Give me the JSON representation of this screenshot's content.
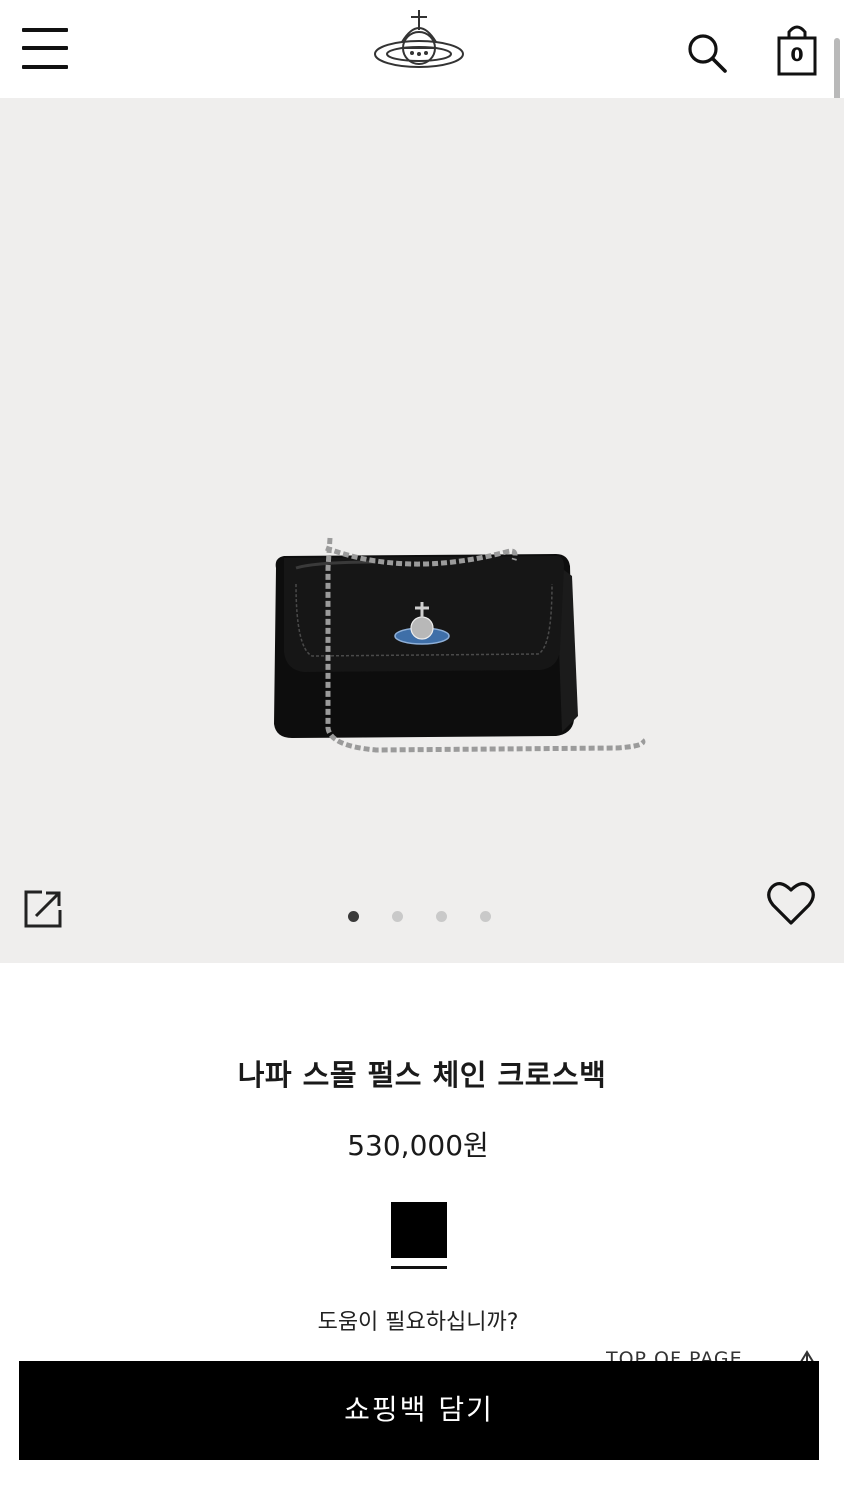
{
  "header": {
    "menu_icon": "hamburger-menu-icon",
    "logo_icon": "orb-logo-icon",
    "search_icon": "search-icon",
    "bag_icon": "shopping-bag-icon",
    "bag_count": "0"
  },
  "gallery": {
    "image_count": 4,
    "active_index": 0,
    "share_icon": "share-icon",
    "wishlist_icon": "heart-icon",
    "background_color": "#efeeed"
  },
  "product": {
    "name": "나파 스몰 펄스 체인 크로스백",
    "price": "530,000원",
    "selected_color": "#000000"
  },
  "help_text": "도움이 필요하십니까?",
  "top_of_page_label": "TOP OF PAGE",
  "add_to_bag_label": "쇼핑백 담기"
}
